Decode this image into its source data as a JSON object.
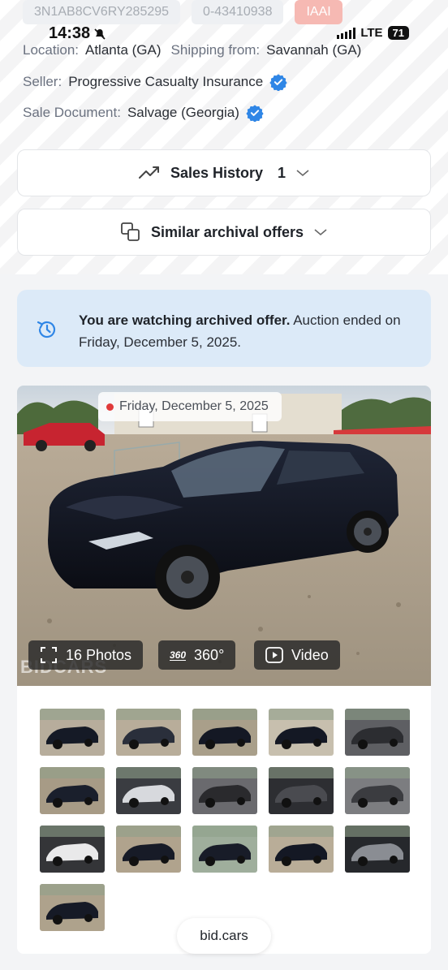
{
  "top_chips": {
    "vin": "3N1AB8CV6RY285295",
    "lot": "0-43410938",
    "auction": "IAAI"
  },
  "status_bar": {
    "time": "14:38",
    "network": "LTE",
    "battery": "71"
  },
  "details": {
    "location_label": "Location:",
    "location_value": "Atlanta (GA)",
    "shipping_label": "Shipping from:",
    "shipping_value": "Savannah (GA)",
    "seller_label": "Seller:",
    "seller_value": "Progressive Casualty Insurance",
    "doc_label": "Sale Document:",
    "doc_value": "Salvage (Georgia)"
  },
  "sales_history": {
    "label": "Sales History",
    "count": "1"
  },
  "similar": {
    "label": "Similar archival offers"
  },
  "notice": {
    "bold": "You are watching archived offer.",
    "rest": " Auction ended on Friday, December 5, 2025."
  },
  "photo": {
    "date": "Friday, December 5, 2025",
    "photos_label": "16 Photos",
    "spin_label": "360°",
    "spin_badge": "360",
    "video_label": "Video",
    "watermark": "BIDCARS"
  },
  "thumbnails": [
    {
      "name": "thumb-front-left"
    },
    {
      "name": "thumb-front-right"
    },
    {
      "name": "thumb-rear-left"
    },
    {
      "name": "thumb-rear-right"
    },
    {
      "name": "thumb-interior-trunk"
    },
    {
      "name": "thumb-front-damage"
    },
    {
      "name": "thumb-instrument-cluster"
    },
    {
      "name": "thumb-floor-mat"
    },
    {
      "name": "thumb-trunk"
    },
    {
      "name": "thumb-engine-bay"
    },
    {
      "name": "thumb-key"
    },
    {
      "name": "thumb-front"
    },
    {
      "name": "thumb-side"
    },
    {
      "name": "thumb-side-2"
    },
    {
      "name": "thumb-dashboard"
    },
    {
      "name": "thumb-rear"
    }
  ],
  "footer": {
    "site": "bid.cars"
  },
  "colors": {
    "accent_blue": "#2f86e6",
    "notice_bg": "#dceaf8",
    "auction_red": "#f6b9b3",
    "dot_red": "#e03a3a"
  }
}
